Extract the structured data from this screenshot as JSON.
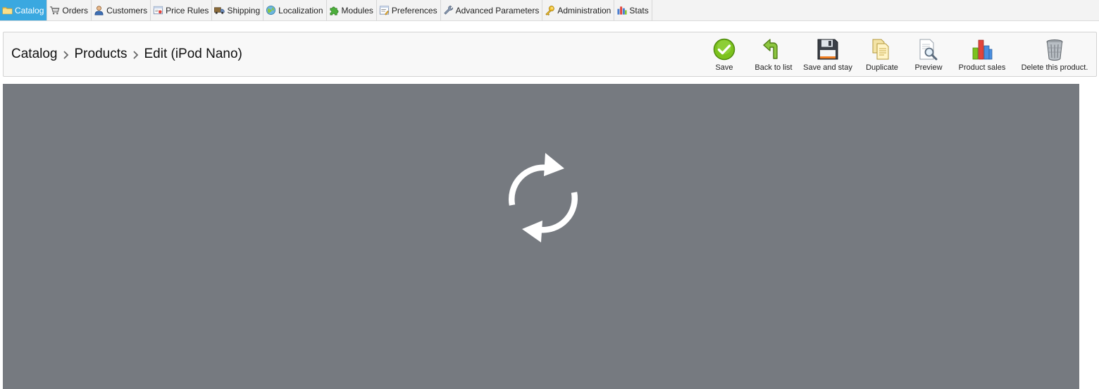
{
  "nav": {
    "tabs": [
      {
        "label": "Catalog",
        "icon": "folder-icon",
        "active": true
      },
      {
        "label": "Orders",
        "icon": "cart-icon",
        "active": false
      },
      {
        "label": "Customers",
        "icon": "user-icon",
        "active": false
      },
      {
        "label": "Price Rules",
        "icon": "price-tag-icon",
        "active": false
      },
      {
        "label": "Shipping",
        "icon": "truck-icon",
        "active": false
      },
      {
        "label": "Localization",
        "icon": "globe-icon",
        "active": false
      },
      {
        "label": "Modules",
        "icon": "puzzle-icon",
        "active": false
      },
      {
        "label": "Preferences",
        "icon": "form-icon",
        "active": false
      },
      {
        "label": "Advanced Parameters",
        "icon": "wrench-icon",
        "active": false
      },
      {
        "label": "Administration",
        "icon": "key-icon",
        "active": false
      },
      {
        "label": "Stats",
        "icon": "bar-chart-icon",
        "active": false
      }
    ]
  },
  "breadcrumb": {
    "items": [
      "Catalog",
      "Products",
      "Edit (iPod Nano)"
    ]
  },
  "toolbar": {
    "buttons": [
      {
        "label": "Save",
        "icon": "checkmark-icon"
      },
      {
        "label": "Back to list",
        "icon": "back-arrow-icon"
      },
      {
        "label": "Save and stay",
        "icon": "floppy-disk-icon"
      },
      {
        "label": "Duplicate",
        "icon": "copy-icon"
      },
      {
        "label": "Preview",
        "icon": "magnifier-icon"
      },
      {
        "label": "Product sales",
        "icon": "bar-chart-icon"
      },
      {
        "label": "Delete this product.",
        "icon": "trash-icon"
      }
    ]
  },
  "overlay": {
    "state": "loading",
    "icon": "refresh-icon"
  },
  "colors": {
    "active_tab": "#3aa8e0",
    "overlay": "#767a80",
    "save_green": "#7cc21e"
  }
}
